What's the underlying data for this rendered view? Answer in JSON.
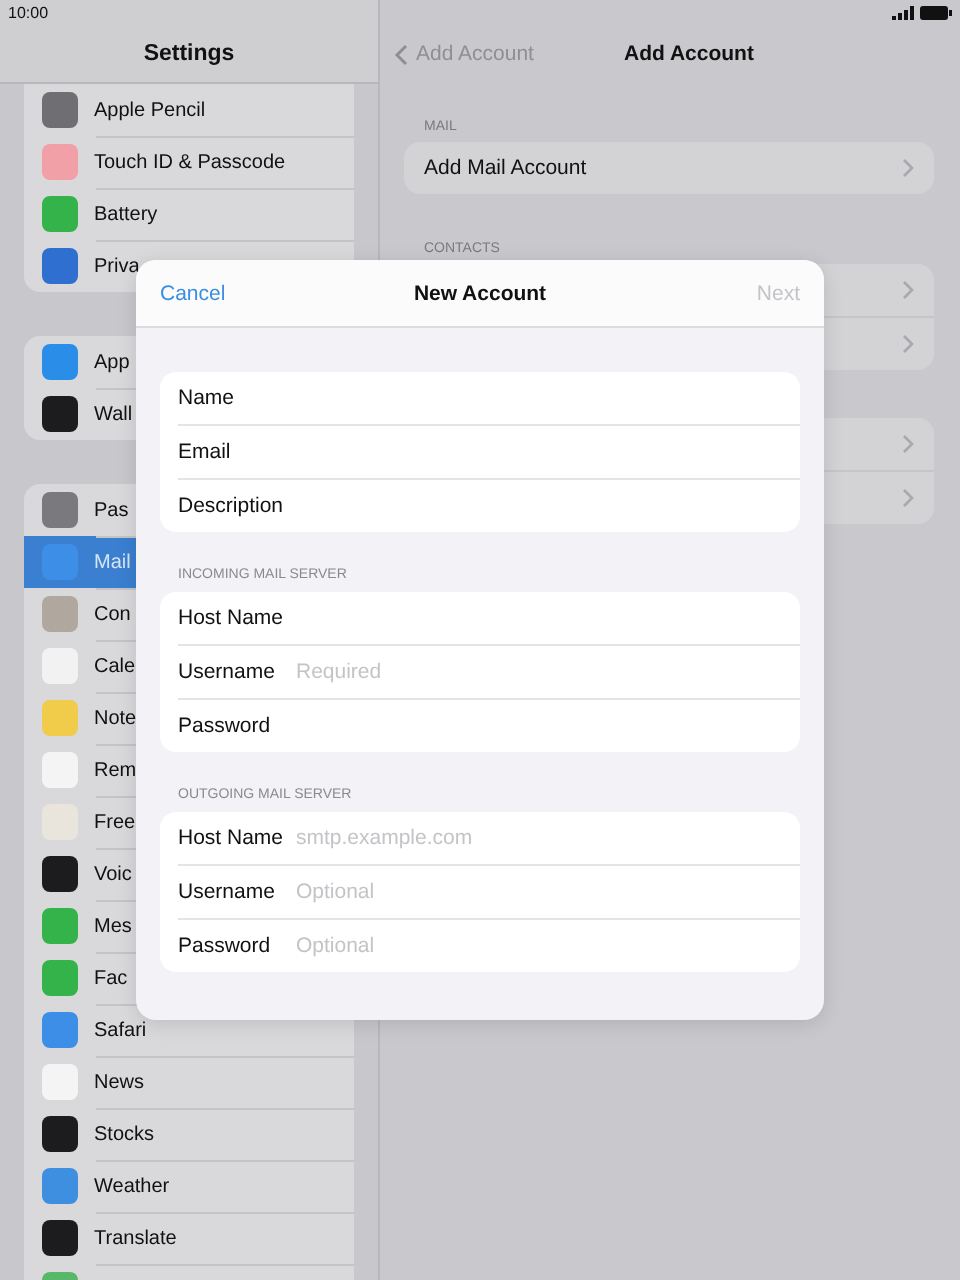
{
  "status_bar": {
    "time": "10:00"
  },
  "sidebar": {
    "title": "Settings",
    "groups": [
      {
        "items": [
          {
            "label": "Apple Pencil",
            "color": "#6e6e73",
            "selected": false
          },
          {
            "label": "Touch ID & Passcode",
            "color": "#f2a0a8",
            "selected": false
          },
          {
            "label": "Battery",
            "color": "#34b34a",
            "selected": false
          },
          {
            "label": "Priva",
            "color": "#2f6fd0",
            "selected": false
          }
        ]
      },
      {
        "items": [
          {
            "label": "App",
            "color": "#2a8de8",
            "selected": false
          },
          {
            "label": "Wall",
            "color": "#1c1c1e",
            "selected": false
          }
        ]
      },
      {
        "items": [
          {
            "label": "Pas",
            "color": "#7a7a7e",
            "selected": false
          },
          {
            "label": "Mail",
            "color": "#3d8ee6",
            "selected": true
          },
          {
            "label": "Con",
            "color": "#b0a89e",
            "selected": false
          },
          {
            "label": "Cale",
            "color": "#f2f2f2",
            "selected": false
          },
          {
            "label": "Note",
            "color": "#f0cc4a",
            "selected": false
          },
          {
            "label": "Rem",
            "color": "#f4f4f4",
            "selected": false
          },
          {
            "label": "Free",
            "color": "#e9e4dc",
            "selected": false
          },
          {
            "label": "Voic",
            "color": "#1c1c1e",
            "selected": false
          },
          {
            "label": "Mes",
            "color": "#34b34a",
            "selected": false
          },
          {
            "label": "Fac",
            "color": "#34b34a",
            "selected": false
          },
          {
            "label": "Safari",
            "color": "#3d8ee6",
            "selected": false
          },
          {
            "label": "News",
            "color": "#f4f4f4",
            "selected": false
          },
          {
            "label": "Stocks",
            "color": "#1c1c1e",
            "selected": false
          },
          {
            "label": "Weather",
            "color": "#3f8fe0",
            "selected": false
          },
          {
            "label": "Translate",
            "color": "#1c1c1e",
            "selected": false
          },
          {
            "color": "#58b86a",
            "selected": false
          }
        ]
      }
    ]
  },
  "detail": {
    "back": "Add Account",
    "title": "Add Account",
    "sections": [
      {
        "header": "MAIL",
        "rows": [
          {
            "kind": "link",
            "label": "Add Mail Account"
          }
        ]
      },
      {
        "header": "CONTACTS",
        "rows": [
          {
            "kind": "covered"
          },
          {
            "kind": "covered"
          }
        ]
      },
      {
        "rows": [
          {
            "kind": "covered"
          },
          {
            "kind": "covered"
          }
        ]
      }
    ]
  },
  "sheet": {
    "cancel": "Cancel",
    "title": "New Account",
    "next": "Next",
    "next_disabled": true,
    "groups": [
      {
        "fields": [
          {
            "label": "Name"
          },
          {
            "label": "Email"
          },
          {
            "label": "Description"
          }
        ]
      },
      {
        "header": "INCOMING MAIL SERVER",
        "fields": [
          {
            "label": "Host Name"
          },
          {
            "label": "Username",
            "placeholder": "Required"
          },
          {
            "label": "Password"
          }
        ]
      },
      {
        "header": "OUTGOING MAIL SERVER",
        "fields": [
          {
            "label": "Host Name",
            "placeholder": "smtp.example.com"
          },
          {
            "label": "Username",
            "placeholder": "Optional"
          },
          {
            "label": "Password",
            "placeholder": "Optional"
          }
        ]
      }
    ]
  }
}
